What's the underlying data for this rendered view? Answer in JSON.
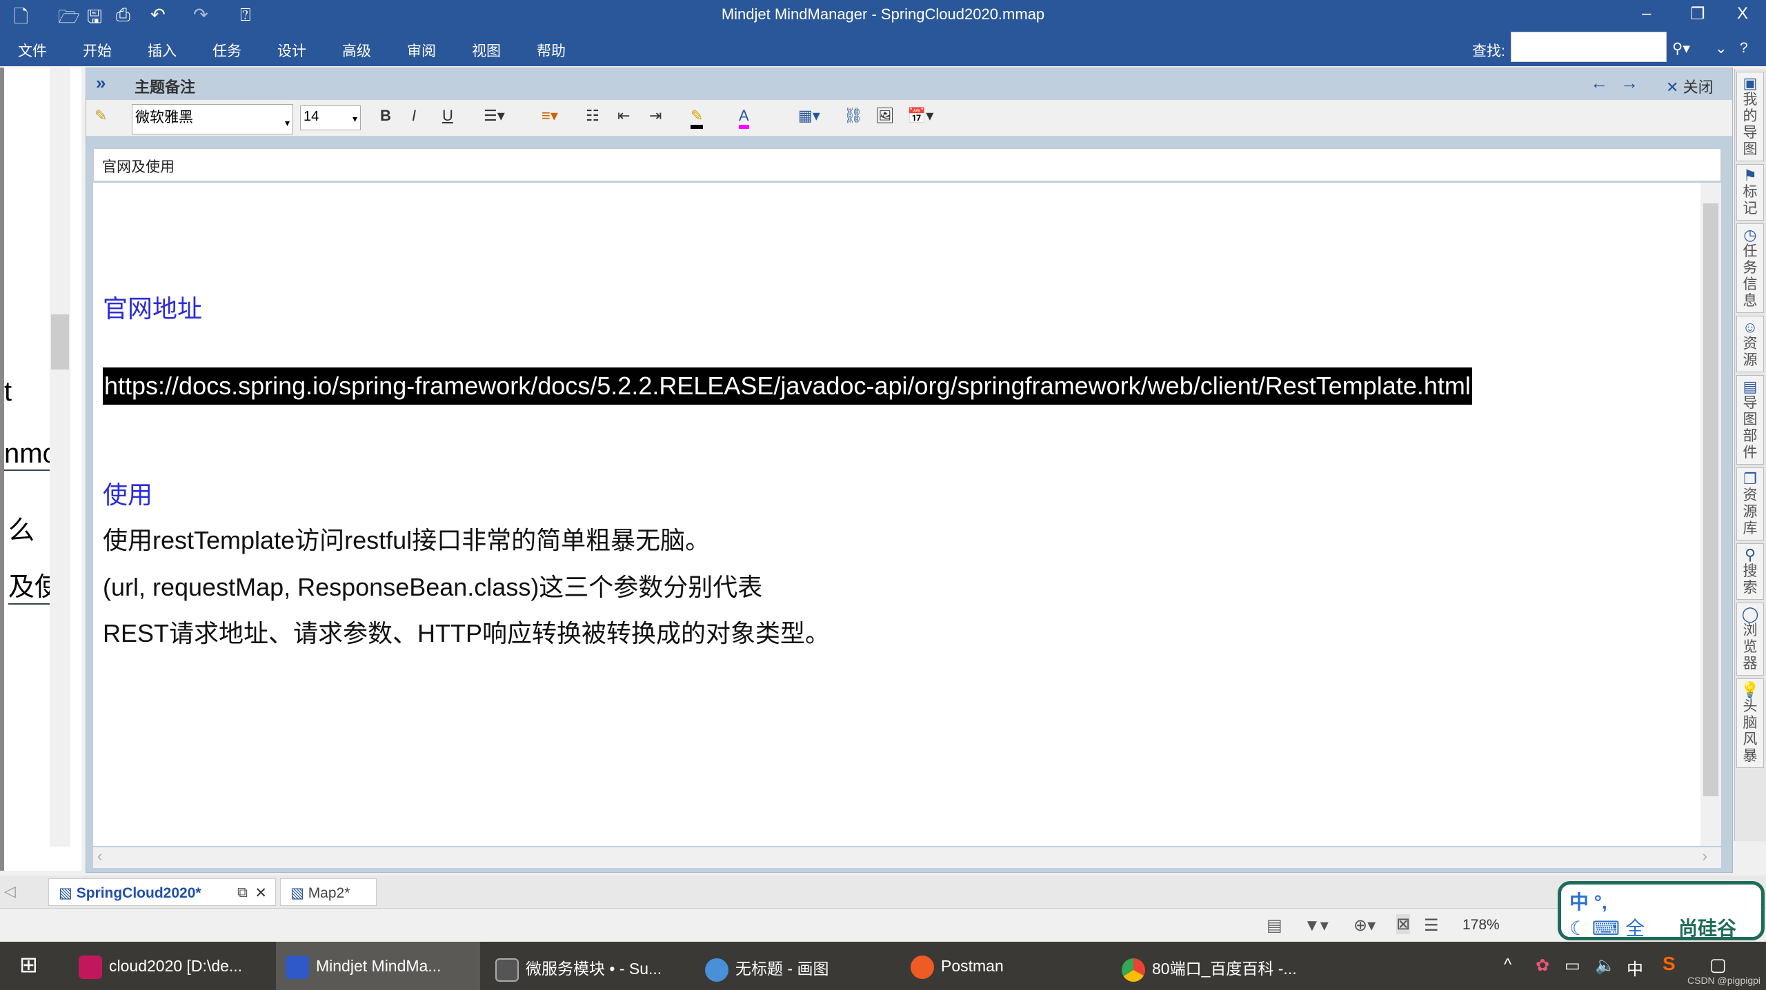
{
  "window": {
    "title": "Mindjet MindManager - SpringCloud2020.mmap",
    "minimize": "‒",
    "restore": "❐",
    "close": "X"
  },
  "quick_access": [
    "new-icon",
    "open-icon",
    "save-icon",
    "print-icon",
    "undo-icon",
    "redo-icon",
    "help-icon"
  ],
  "menu": [
    "文件",
    "开始",
    "插入",
    "任务",
    "设计",
    "高级",
    "审阅",
    "视图",
    "帮助"
  ],
  "find": {
    "label": "查找:",
    "value": ""
  },
  "notes": {
    "header": "主题备注",
    "expand": "»",
    "close": "关闭",
    "font": "微软雅黑",
    "size": "14",
    "topic_title": "官网及使用",
    "toolbar": {
      "bold": "B",
      "italic": "I",
      "underline": "U"
    },
    "content": {
      "heading1": "官网地址",
      "url": "https://docs.spring.io/spring-framework/docs/5.2.2.RELEASE/javadoc-api/org/springframework/web/client/RestTemplate.html",
      "heading2": "使用",
      "lines": [
        "使用restTemplate访问restful接口非常的简单粗暴无脑。",
        "(url, requestMap, ResponseBean.class)这三个参数分别代表",
        "REST请求地址、请求参数、HTTP响应转换被转换成的对象类型。"
      ]
    }
  },
  "left_pane_fragments": [
    "t",
    "nmo",
    "么",
    "及使"
  ],
  "side_tabs": [
    "我的导图",
    "标记",
    "任务信息",
    "资源",
    "导图部件",
    "资源库",
    "搜索",
    "浏览器",
    "头脑风暴"
  ],
  "doc_tabs": [
    {
      "label": "SpringCloud2020*",
      "active": true
    },
    {
      "label": "Map2*",
      "active": false
    }
  ],
  "status": {
    "zoom": "178%"
  },
  "ime": {
    "top": "中 °, ",
    "bottom": "全",
    "brand": "尚硅谷"
  },
  "taskbar": {
    "items": [
      {
        "label": "cloud2020 [D:\\de...",
        "color": "#c2185b"
      },
      {
        "label": "Mindjet MindMa...",
        "color": "#2f58c8",
        "active": true
      },
      {
        "label": "微服务模块 • - Su...",
        "color": "#555"
      },
      {
        "label": "无标题 - 画图",
        "color": "#4a90d9"
      },
      {
        "label": "Postman",
        "color": "#ef5b25"
      },
      {
        "label": "80端口_百度百科 -...",
        "color": "#34a853"
      }
    ],
    "tray_ime": "中",
    "watermark": "CSDN @pigpigpi"
  },
  "colors": {
    "titlebar": "#2a579a",
    "heading": "#2b2bd8",
    "selection": "#000000"
  }
}
